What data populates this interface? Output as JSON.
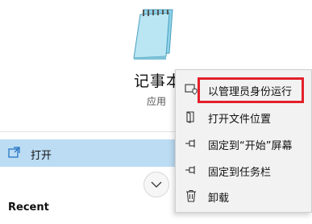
{
  "app": {
    "title": "记事本",
    "type": "应用",
    "icon": "notepad-icon"
  },
  "actions": {
    "open_label": "打开",
    "open_icon": "open-window-icon"
  },
  "recent": {
    "heading": "Recent"
  },
  "context_menu": {
    "items": [
      {
        "label": "以管理员身份运行",
        "icon": "run-as-admin-icon"
      },
      {
        "label": "打开文件位置",
        "icon": "folder-location-icon"
      },
      {
        "label": "固定到“开始”屏幕",
        "icon": "pin-icon"
      },
      {
        "label": "固定到任务栏",
        "icon": "pin-icon"
      },
      {
        "label": "卸载",
        "icon": "trash-icon"
      }
    ],
    "highlighted_item": "以管理员身份运行"
  },
  "colors": {
    "selected_row": "#bcdcf4",
    "highlight_border": "#e3202b",
    "menu_background": "#f2f2f2"
  }
}
